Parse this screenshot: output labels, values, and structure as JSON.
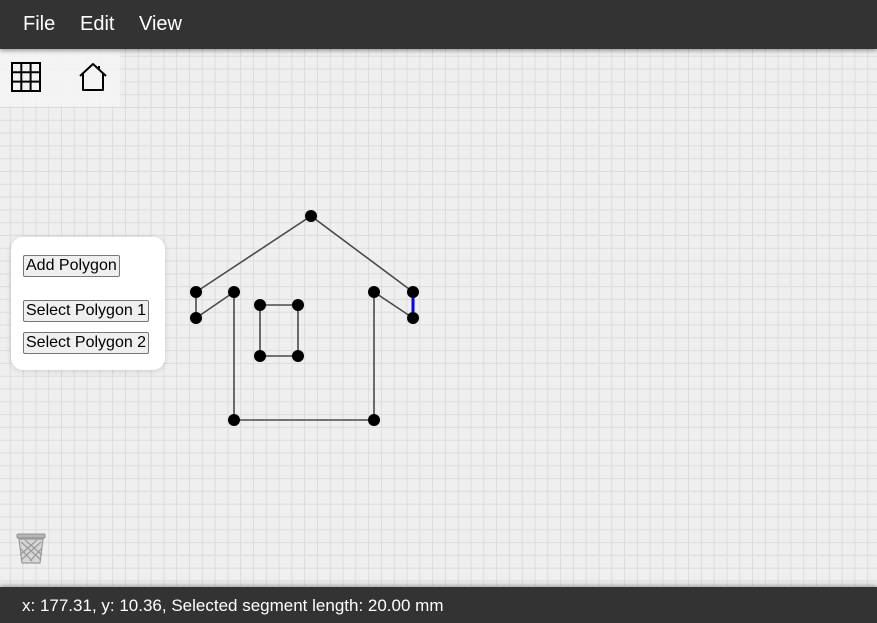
{
  "menu": {
    "file": "File",
    "edit": "Edit",
    "view": "View"
  },
  "toolbar": {
    "grid_icon": "grid-icon",
    "home_icon": "home-icon"
  },
  "panel": {
    "add_polygon": "Add Polygon",
    "select_polygon_1": "Select Polygon 1",
    "select_polygon_2": "Select Polygon 2"
  },
  "trash_icon": "trash-icon",
  "status": {
    "text": "x: 177.31, y: 10.36, Selected segment length: 20.00 mm"
  },
  "colors": {
    "chrome": "#333333",
    "selected_segment": "#0000ff",
    "vertex": "#000000"
  }
}
